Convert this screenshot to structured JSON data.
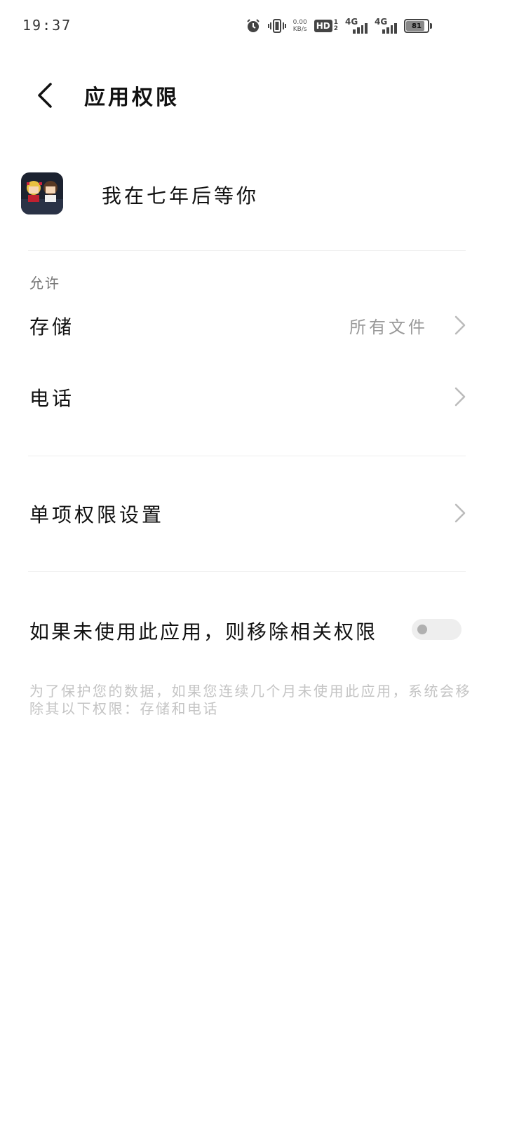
{
  "status_bar": {
    "time": "19:37",
    "net_speed_value": "0.00",
    "net_speed_unit": "KB/s",
    "hd_label": "HD",
    "sim1_label": "4G",
    "sim2_label": "4G",
    "battery_level": "81",
    "icons": [
      "alarm-icon",
      "vibrate-icon",
      "hd-icon",
      "signal-icon",
      "battery-icon"
    ]
  },
  "header": {
    "title": "应用权限",
    "back_icon": "chevron-left-icon"
  },
  "app": {
    "name": "我在七年后等你"
  },
  "allowed_section": {
    "label": "允许",
    "items": [
      {
        "label": "存储",
        "value": "所有文件"
      },
      {
        "label": "电话",
        "value": ""
      }
    ]
  },
  "single_permission": {
    "label": "单项权限设置"
  },
  "auto_remove": {
    "label": "如果未使用此应用，则移除相关权限",
    "enabled": false,
    "note": "为了保护您的数据，如果您连续几个月未使用此应用，系统会移除其以下权限：存储和电话"
  },
  "colors": {
    "text_primary": "#111111",
    "text_secondary": "#9a9a9a",
    "note": "#c4c4c4",
    "divider": "#efefef",
    "toggle_off_track": "#eeeeee",
    "toggle_off_knob": "#b0b0b0"
  }
}
